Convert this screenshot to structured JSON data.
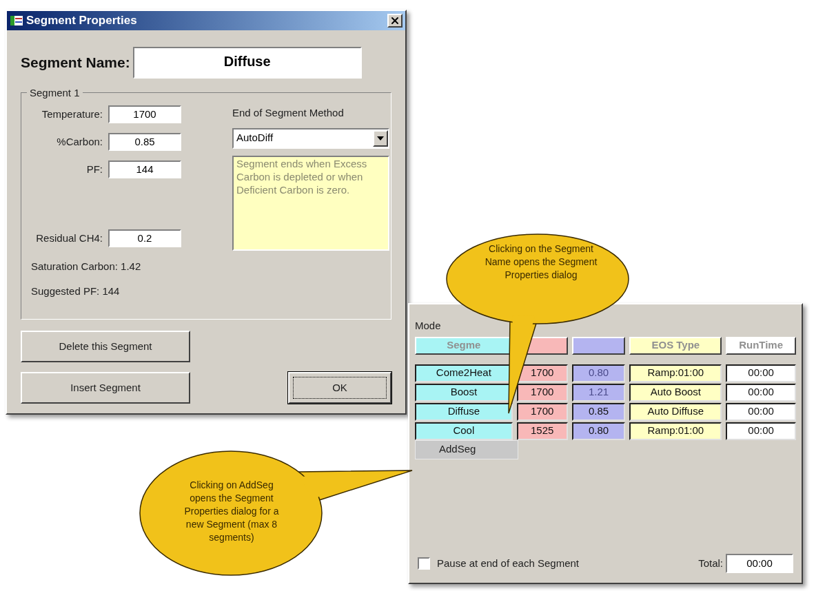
{
  "dialog": {
    "title": "Segment Properties",
    "segment_name": {
      "label": "Segment Name:",
      "value": "Diffuse"
    },
    "group": {
      "title": "Segment 1",
      "fields": [
        {
          "label": "Temperature:",
          "value": "1700"
        },
        {
          "label": "%Carbon:",
          "value": "0.85"
        },
        {
          "label": "PF:",
          "value": "144"
        }
      ],
      "residual": {
        "label": "Residual CH4:",
        "value": "0.2"
      },
      "info": [
        "Saturation Carbon: 1.42",
        "Suggested PF: 144"
      ],
      "method": {
        "label": "End of Segment Method",
        "value": "AutoDiff",
        "description": "Segment ends when Excess Carbon is depleted or when Deficient Carbon is zero."
      }
    },
    "buttons": [
      {
        "label": "Delete this Segment",
        "focused": false
      },
      {
        "label": "Insert Segment",
        "focused": false
      },
      {
        "label": "OK",
        "focused": true
      }
    ]
  },
  "segments_panel": {
    "label": "Mode",
    "columns": [
      {
        "label": "Segme",
        "color": "#a8f4f4"
      },
      {
        "color": "#f8b8b8"
      },
      {
        "color": "#b4b4f0"
      },
      {
        "label": "EOS Type",
        "color": "#ffffc4"
      },
      {
        "label": "RunTime",
        "color": "#ffffff"
      }
    ],
    "rows": [
      {
        "cells": [
          "Come2Heat",
          "1700",
          "0.80",
          "Ramp:01:00",
          "00:00"
        ],
        "carbon_disabled": true
      },
      {
        "cells": [
          "Boost",
          "1700",
          "1.21",
          "Auto Boost",
          "00:00"
        ],
        "carbon_disabled": true
      },
      {
        "cells": [
          "Diffuse",
          "1700",
          "0.85",
          "Auto Diffuse",
          "00:00"
        ],
        "carbon_disabled": false
      },
      {
        "cells": [
          "Cool",
          "1525",
          "0.80",
          "Ramp:01:00",
          "00:00"
        ],
        "carbon_disabled": false
      }
    ],
    "add_button": "AddSeg",
    "pause": {
      "label": "Pause at end of each Segment",
      "checked": false
    },
    "total": {
      "label": "Total:",
      "value": "00:00"
    }
  },
  "callouts": [
    {
      "text": "Clicking on the Segment Name opens the Segment Properties dialog"
    },
    {
      "text": "Clicking on AddSeg opens the Segment Properties dialog for a new Segment (max 8 segments)"
    }
  ]
}
